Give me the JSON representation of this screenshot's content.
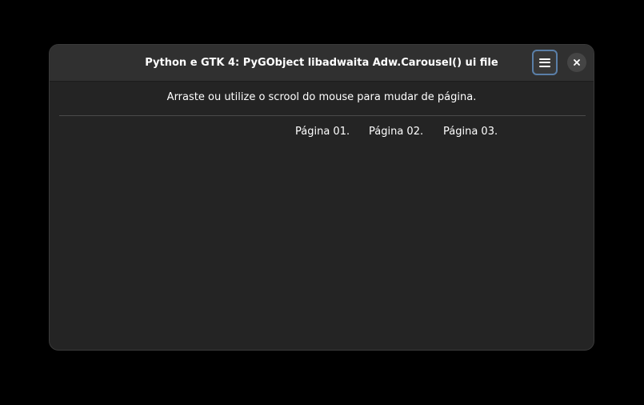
{
  "window": {
    "title": "Python e GTK 4: PyGObject libadwaita Adw.Carousel() ui file"
  },
  "header": {
    "menu_icon": "open-menu-icon",
    "close_icon": "close-icon"
  },
  "content": {
    "instruction": "Arraste ou utilize o scrool do mouse para mudar de página.",
    "pages": [
      {
        "label": "Página 01."
      },
      {
        "label": "Página 02."
      },
      {
        "label": "Página 03."
      }
    ]
  }
}
